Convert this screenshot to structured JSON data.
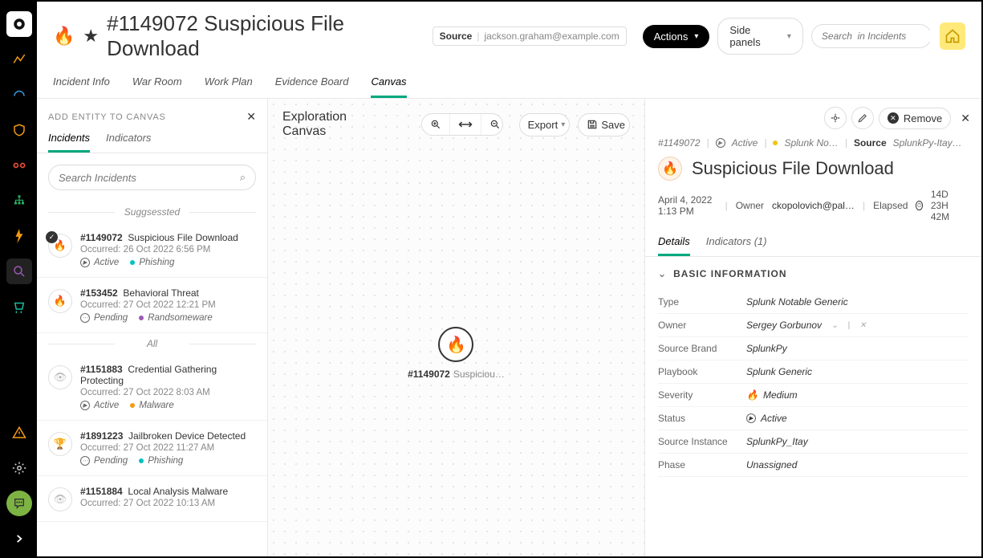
{
  "header": {
    "incident_id": "#1149072",
    "title_text": "Suspicious File Download",
    "source_label": "Source",
    "source_value": "jackson.graham@example.com",
    "actions_label": "Actions",
    "side_panels_label": "Side panels",
    "search_placeholder": "Search  in Incidents"
  },
  "nav_tabs": [
    "Incident Info",
    "War Room",
    "Work Plan",
    "Evidence Board",
    "Canvas"
  ],
  "nav_active": "Canvas",
  "left_panel": {
    "title": "ADD ENTITY TO CANVAS",
    "tabs": [
      "Incidents",
      "Indicators"
    ],
    "tab_active": "Incidents",
    "search_placeholder": "Search Incidents",
    "section_suggested": "Suggsessted",
    "section_all": "All",
    "items_suggested": [
      {
        "id": "#1149072",
        "name": "Suspicious File Download",
        "occurred": "Occurred: 26 Oct 2022 6:56 PM",
        "status": "Active",
        "tag": "Phishing",
        "tag_color": "#00c2c2",
        "icon": "flame",
        "icon_color": "#f39c12",
        "status_icon": "play",
        "selected": true
      },
      {
        "id": "#153452",
        "name": "Behavioral Threat",
        "occurred": "Occurred: 27 Oct 2022 12:21 PM",
        "status": "Pending",
        "tag": "Randsomeware",
        "tag_color": "#9b59b6",
        "icon": "flame",
        "icon_color": "#e74c3c",
        "status_icon": "dots",
        "selected": false
      }
    ],
    "items_all": [
      {
        "id": "#1151883",
        "name": "Credential Gathering Protecting",
        "occurred": "Occurred: 27 Oct 2022 8:03 AM",
        "status": "Active",
        "tag": "Malware",
        "tag_color": "#f39c12",
        "icon": "eye",
        "icon_color": "#bbb",
        "status_icon": "play",
        "selected": false
      },
      {
        "id": "#1891223",
        "name": "Jailbroken Device Detected",
        "occurred": "Occurred: 27 Oct 2022 11:27 AM",
        "status": "Pending",
        "tag": "Phishing",
        "tag_color": "#00c2c2",
        "icon": "trophy",
        "icon_color": "#c0392b",
        "status_icon": "dots",
        "selected": false
      },
      {
        "id": "#1151884",
        "name": "Local Analysis Malware",
        "occurred": "Occurred: 27 Oct 2022 10:13 AM",
        "status": "",
        "tag": "",
        "tag_color": "",
        "icon": "eye",
        "icon_color": "#bbb",
        "status_icon": "",
        "selected": false
      }
    ]
  },
  "canvas": {
    "title": "Exploration Canvas",
    "export_label": "Export",
    "save_label": "Save",
    "node_id": "#1149072",
    "node_name": "Suspiciou…"
  },
  "right_panel": {
    "toolbar_remove": "Remove",
    "meta_id": "#1149072",
    "meta_status": "Active",
    "meta_source1": "Splunk No…",
    "meta_source_label": "Source",
    "meta_source2": "SplunkPy-Itay…",
    "title": "Suspicious File Download",
    "timestamp": "April 4, 2022 1:13 PM",
    "owner_label": "Owner",
    "owner_value": "ckopolovich@pal…",
    "elapsed_label": "Elapsed",
    "elapsed_value": "14D 23H 42M",
    "tabs": {
      "details": "Details",
      "indicators": "Indicators (1)"
    },
    "section_title": "BASIC INFORMATION",
    "fields": [
      {
        "key": "Type",
        "value": "Splunk Notable Generic"
      },
      {
        "key": "Owner",
        "value": "Sergey Gorbunov",
        "editable": true
      },
      {
        "key": "Source Brand",
        "value": "SplunkPy"
      },
      {
        "key": "Playbook",
        "value": "Splunk Generic"
      },
      {
        "key": "Severity",
        "value": "Medium",
        "icon": "flame"
      },
      {
        "key": "Status",
        "value": "Active",
        "icon": "play"
      },
      {
        "key": "Source Instance",
        "value": "SplunkPy_Itay"
      },
      {
        "key": "Phase",
        "value": "Unassigned"
      }
    ]
  }
}
